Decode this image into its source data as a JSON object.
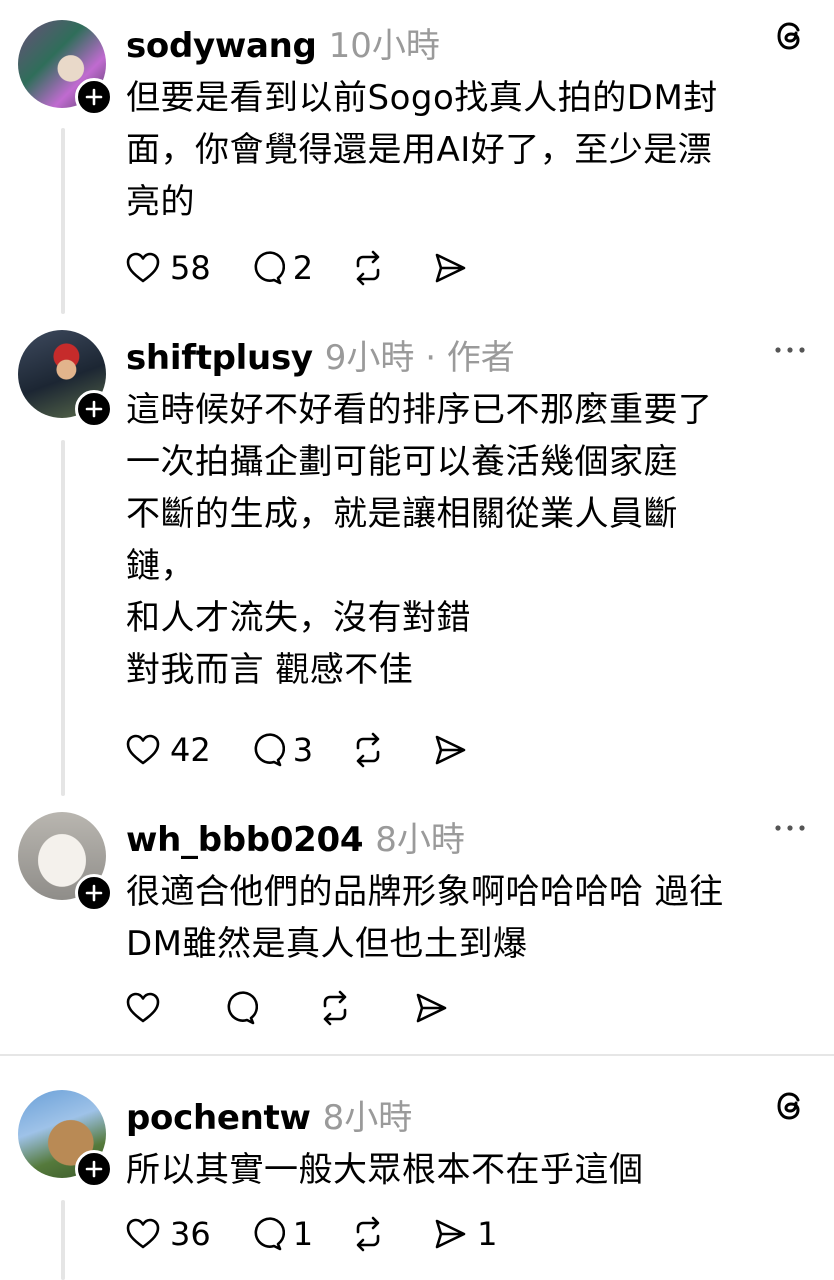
{
  "comments": [
    {
      "username": "sodywang",
      "meta": "10小時",
      "text": "但要是看到以前Sogo找真人拍的DM封\n面，你會覺得還是用AI好了，至少是漂\n亮的",
      "likes": "58",
      "replies": "2",
      "reposts": "",
      "shares": "",
      "top_icon": "threads-logo-icon"
    },
    {
      "username": "shiftplusy",
      "meta": "9小時 · 作者",
      "text": "這時候好不好看的排序已不那麼重要了\n一次拍攝企劃可能可以養活幾個家庭\n不斷的生成，就是讓相關從業人員斷\n鏈，\n和人才流失，沒有對錯\n對我而言 觀感不佳",
      "likes": "42",
      "replies": "3",
      "reposts": "",
      "shares": "",
      "top_icon": "more-icon"
    },
    {
      "username": "wh_bbb0204",
      "meta": "8小時",
      "text": "很適合他們的品牌形象啊哈哈哈哈 過往\nDM雖然是真人但也土到爆",
      "likes": "",
      "replies": "",
      "reposts": "",
      "shares": "",
      "top_icon": "more-icon"
    },
    {
      "username": "pochentw",
      "meta": "8小時",
      "text": "所以其實一般大眾根本不在乎這個",
      "likes": "36",
      "replies": "1",
      "reposts": "",
      "shares": "1",
      "top_icon": "threads-logo-icon"
    }
  ]
}
